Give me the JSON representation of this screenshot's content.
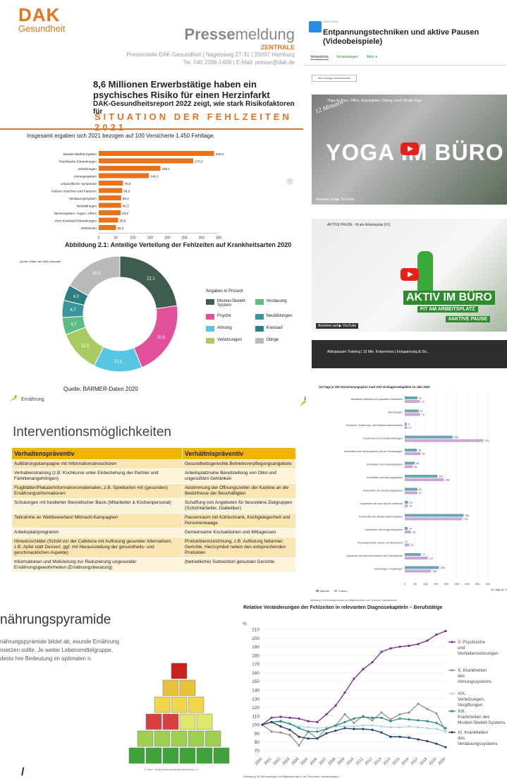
{
  "dak": {
    "logo_main": "DAK",
    "logo_sub": "Gesundheit",
    "press_brand_bold": "Presse",
    "press_brand_light": "meldung",
    "zentrale": "ZENTRALE",
    "address1": "Pressestelle DAK-Gesundheit | Nagelsweg 27-31 | 20097 Hamburg",
    "address2": "Tel. 040 2396-1409 | E-Mail: presse@dak.de",
    "headline": "8,6 Millionen Erwerbstätige haben ein psychisches Risiko für einen Herzinfarkt",
    "subline": "DAK-Gesundheitsreport 2022 zeigt, wie stark Risikofaktoren für",
    "situation": "SITUATION DER FEHLZEITEN 2021",
    "intro": "Insgesamt ergaben sich 2021 bezogen auf 100 Versicherte 1.450 Fehltage.",
    "fig_caption": "Abbildung 2.1: Anteilige Verteilung der Fehlzeiten auf Krankheitsarten 2020",
    "quelle_small": "Quelle: Daten der DAK-Gesundh",
    "quelle": "Quelle: BARMER-Daten 2020",
    "legend_title": "Angaben in Prozent"
  },
  "video": {
    "meta": "VIDEOVIDA",
    "title": "Entpannungstechniken und aktive Pausen (Videobeispiele)",
    "tabs": [
      "Verzeichnis",
      "Einstellungen",
      "Mehr ▾"
    ],
    "button": "Alle erledigt kennzeichnen",
    "v1_title": "Yoga im Büro, Office, Arbeitsplatz | Sitting Lunch Break Yoge",
    "v1_overlay": "YOGA IM BÜRO",
    "v1_hand": "12 Minuten",
    "v2_title": "AKTIVE PAUSE - fit am Arbeitsplatz [#1]",
    "v2_overlay1": "AKTIV IM BÜRO",
    "v2_overlay2": "FIT AM ARBEITSPLATZ",
    "v2_overlay3": "#AKTIVE PAUSE",
    "v3_title": "Aktivpausen-Training | 15 Min. Korperreise | Entspannung & Str...",
    "watch_on": "Ansehen auf  ▶ YouTube"
  },
  "ernaehrung": {
    "label": "Ernährung"
  },
  "interventions": {
    "title": "Interventionsmöglichkeiten",
    "col1": "Verhaltenspräventiv",
    "col2": "Verhältnispräventiv",
    "rows": [
      [
        "Aufklärungskampagne mit Informationsbroschüren",
        "Gesundheitsgerechte Betriebsverpflegungsangebote"
      ],
      [
        "Verhaltenstraining (z.B. Kochkurse unter Einbeziehung der Partner und Familienangehörigen)",
        "Arbeitsplatznahe Bereitstellung von Obst und ungesüßten Getränken"
      ],
      [
        "Flugblätter/Plakate/Informationsmaterialien, z.B. Spielkarten mit (gesunden) Ernährungsinformationen",
        "Abstimmung der Öffnungszeiten der Kantine an die Bedürfnisse der Beschäftigten"
      ],
      [
        "Schulungen mit fundierter theoretischer Basis (Mitarbeiter & Küchenpersonal)",
        "Schaffung von Angeboten für besondere Zielgruppen (Schichtarbeiter, Diabetiker)"
      ],
      [
        "Teilnahme an Wettbewerben/ Mitmach-Kampagnen",
        "Pausenraum mit Kühlschrank, Kochgelegenheit und Personenwaage"
      ],
      [
        "Arbeitsplatzprogramm",
        "Gemeinsame Kochaktionen und Mittagessen"
      ],
      [
        "Hinweisschilder (Schild vor der Cafeteria mit Auflistung gesunder Alternativen, z.B. Apfel statt Dessert, ggf. mit Herausstellung der gesundheits- und geschmacklichen Aspekte)",
        "Produktkennzeichnung, z.B. Auflistung fettarmer Gerichte, Herzsymbol neben den entsprechenden Produkten"
      ],
      [
        "Informationen und Motivierung zur Reduzierung ungesunder Ernährungsgewohnheiten (Ernährungsberatung)",
        "(betriebliche) Subvention gesunder Gerichte"
      ]
    ]
  },
  "pyramid": {
    "title": "nährungspyramide",
    "text": "nährungspyramide bildet ab, esunde Ernährung nsetzen sollte. Je weiter Lebensmittelgruppe, desto hre Bedeutung im optimalen n.",
    "source": "© Idee: Sonja Mannhardt/aid infodienst e.V.",
    "slash": "/"
  },
  "chart_data": [
    {
      "type": "bar",
      "title": "",
      "categories": [
        "Muskel-Skelett-System",
        "Psychische Erkrankungen",
        "Verletzungen",
        "Atmungssystem",
        "unspezifische Symptome",
        "Äußere Ursachen und Faktoren",
        "Verdauungssystem",
        "Neubildungen",
        "Nervensystem, Augen, Ohren",
        "Herz-Kreislauf-Erkrankungen",
        "Infektionen"
      ],
      "values": [
        336.8,
        275.9,
        180.1,
        146.3,
        70.6,
        68.6,
        65.4,
        65.3,
        63.9,
        56.8,
        50.3
      ],
      "xlim": [
        0,
        350
      ],
      "xticks": [
        0,
        50,
        100,
        150,
        200,
        250,
        300,
        350
      ],
      "color": "#e8731c"
    },
    {
      "type": "pie",
      "categories": [
        "Muskel-Skelett-System",
        "Psyche",
        "Atmung",
        "Verletzungen",
        "Verdauung",
        "Neubildungen",
        "Kreislauf",
        "Übrige"
      ],
      "values": [
        22.1,
        20.5,
        13.2,
        11.5,
        4.7,
        4.7,
        4.3,
        16.3
      ],
      "colors": [
        "#3f5d4e",
        "#e24f9a",
        "#58c6e2",
        "#a8cc61",
        "#5bbd84",
        "#37979a",
        "#2b7d7e",
        "#b9b9b9"
      ],
      "legend": "right"
    },
    {
      "type": "bar",
      "title": "AU-Tage je 100 Versicherungsjahre nach ICD-10-Diagnosekapiteln im Jahr 2020",
      "orientation": "horizontal",
      "categories": [
        "Bestimmte infektiöse und parasitäre Krankheiten",
        "Neubildungen",
        "Endokrine, Ernährungs- und Stoffwechselkrankheiten",
        "Psychische und Verhaltensstörungen",
        "Krankheiten des Nervensystems und der Sinnesorgane",
        "Krankheiten des Kreislaufsystems",
        "Krankheiten des Atmungssystems",
        "Krankheiten des Verdauungssystems",
        "Krankheiten der Haut und der Unterhaut",
        "Krankheiten des Muskel-Skelett-Systems",
        "Krankheiten des Urogenitalsystems",
        "Schwangerschaft, Geburt und Wochenbett",
        "Symptome und abnorme klinische und Laborbefunde",
        "Verletzungen, Vergiftungen"
      ],
      "series": [
        {
          "name": "Männer",
          "values": [
            61,
            67,
            9,
            230,
            58,
            48,
            157,
            61,
            16,
            283,
            14,
            0,
            77,
            165
          ],
          "color": "#6aa6b2"
        },
        {
          "name": "Frauen",
          "values": [
            73,
            74,
            12,
            378,
            76,
            38,
            188,
            61,
            14,
            276,
            30,
            22,
            111,
            126
          ],
          "color": "#c9a6d6"
        }
      ],
      "xlim": [
        0,
        400
      ],
      "xticks": [
        0,
        50,
        100,
        150,
        200,
        250,
        300,
        350,
        400
      ],
      "xlabel": "AU-Tage (je 100 V.)",
      "footnote": "Abbildung 19 (Erwerbspersonen mit Mitgliedschaft in der Techniker, standardisiert)"
    },
    {
      "type": "line",
      "title": "Relative Veränderungen der Fehlzeiten in relevanten Diagnosekapiteln – Berufstätige",
      "x": [
        "2000",
        "2001",
        "2002",
        "2003",
        "2004",
        "2005",
        "2006",
        "2007",
        "2008",
        "2009",
        "2010",
        "2011",
        "2012",
        "2013",
        "2014",
        "2015",
        "2016",
        "2017",
        "2018",
        "2019",
        "2020"
      ],
      "ylabel": "%",
      "ylim": [
        70,
        210
      ],
      "yticks": [
        70,
        80,
        90,
        100,
        110,
        120,
        130,
        140,
        150,
        160,
        170,
        180,
        190,
        200,
        210
      ],
      "series": [
        {
          "name": "V. Psychische und Verhaltensstörungen",
          "color": "#7b2b8e",
          "values": [
            100,
            108,
            109,
            108,
            107,
            104,
            103,
            112,
            122,
            137,
            153,
            164,
            172,
            184,
            188,
            190,
            191,
            193,
            197,
            204,
            208
          ]
        },
        {
          "name": "X. Krankheiten des Atmungssystems",
          "color": "#9b8e8e",
          "values": [
            100,
            92,
            91,
            88,
            76,
            92,
            84,
            96,
            99,
            112,
            102,
            110,
            105,
            114,
            106,
            112,
            114,
            124,
            118,
            113,
            92
          ]
        },
        {
          "name": "XIX. Verletzungen, Vergiftungen",
          "color": "#a9d8e0",
          "values": [
            100,
            103,
            103,
            101,
            98,
            97,
            96,
            97,
            98,
            98,
            98,
            99,
            99,
            98,
            97,
            97,
            98,
            97,
            96,
            95,
            92
          ]
        },
        {
          "name": "XIII. Krankheiten des Muskel-Skelett-Systems",
          "color": "#2a8a8a",
          "values": [
            100,
            103,
            104,
            101,
            96,
            92,
            92,
            95,
            99,
            103,
            107,
            109,
            108,
            108,
            104,
            107,
            106,
            105,
            104,
            102,
            96
          ]
        },
        {
          "name": "XI. Krankheiten des Verdauungssystems",
          "color": "#1f3e6e",
          "values": [
            100,
            103,
            98,
            94,
            86,
            84,
            84,
            90,
            93,
            96,
            95,
            95,
            94,
            91,
            86,
            86,
            85,
            83,
            81,
            78,
            74
          ]
        }
      ],
      "legend": "right",
      "footnote": "Abbildung 18 (Berufstätige mit Mitgliedschaft in der Techniker, standardisiert)"
    }
  ]
}
